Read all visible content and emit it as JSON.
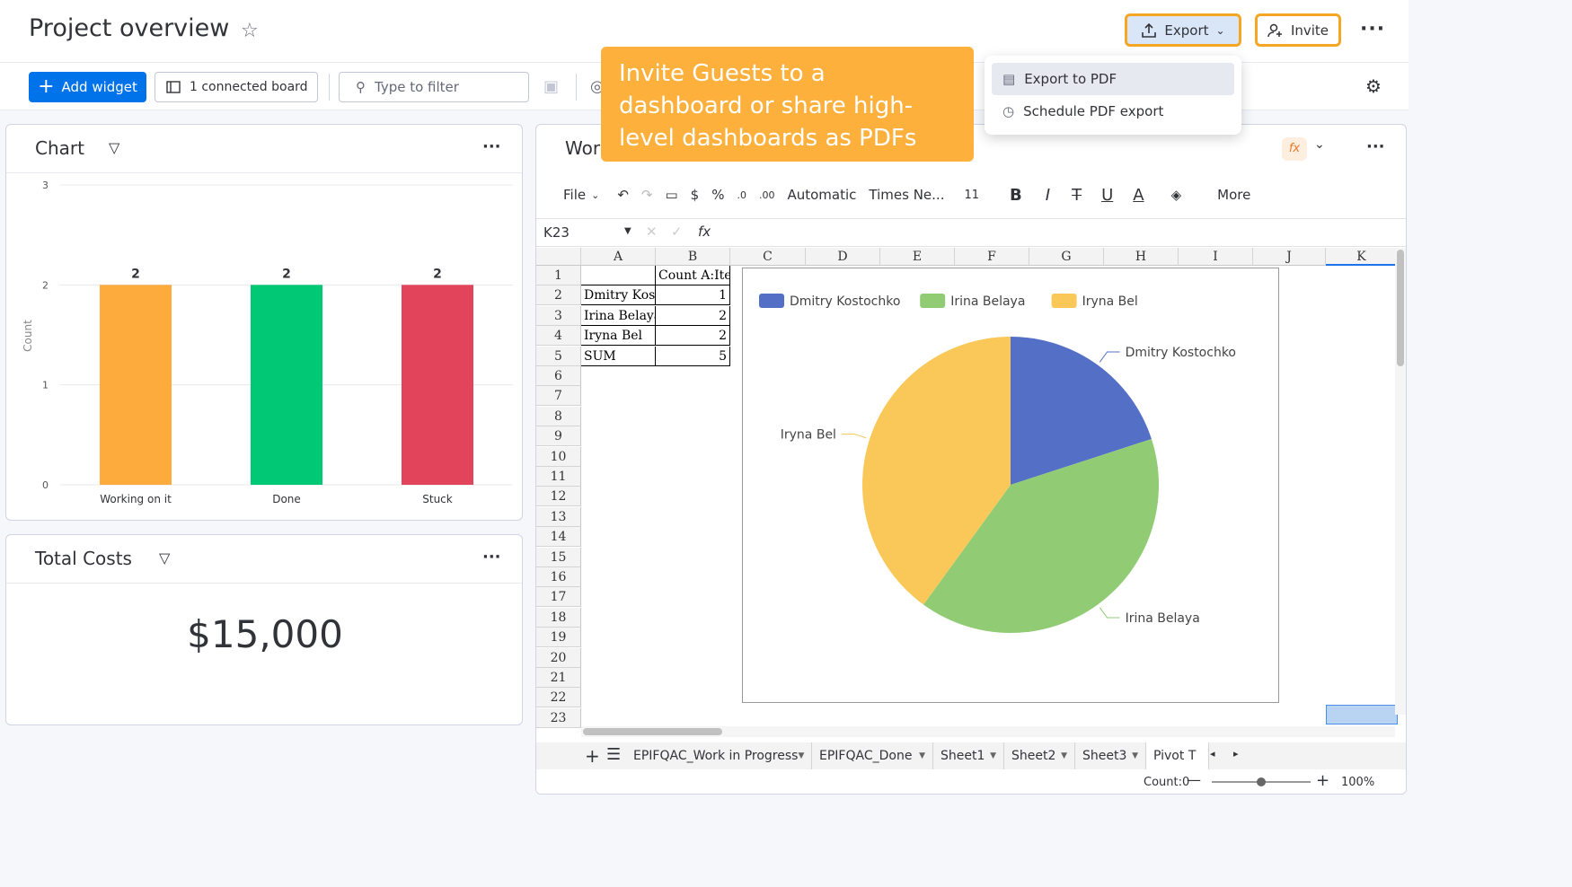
{
  "header": {
    "title": "Project overview",
    "export_label": "Export",
    "invite_label": "Invite"
  },
  "toolbar": {
    "add_widget_label": "Add widget",
    "connected_label": "1 connected board",
    "filter_placeholder": "Type to filter"
  },
  "tooltip": {
    "text": "Invite Guests to a dashboard or share high-level dashboards as PDFs"
  },
  "export_menu": {
    "items": [
      {
        "label": "Export to PDF"
      },
      {
        "label": "Schedule PDF export"
      }
    ]
  },
  "chart_widget": {
    "title": "Chart"
  },
  "costs_widget": {
    "title": "Total Costs",
    "value": "$15,000"
  },
  "workdoc_widget": {
    "title": "Wor"
  },
  "sheet": {
    "toolbar": {
      "file": "File",
      "dollar": "$",
      "percent": "%",
      "number_format": "Automatic",
      "font": "Times Ne...",
      "font_size": "11",
      "bold": "B",
      "italic": "I",
      "underline": "U",
      "font_color": "A",
      "more": "More"
    },
    "cell_ref": "K23",
    "fx": "fx",
    "columns": [
      "A",
      "B",
      "C",
      "D",
      "E",
      "F",
      "G",
      "H",
      "I",
      "J",
      "K"
    ],
    "rows": [
      "1",
      "2",
      "3",
      "4",
      "5",
      "6",
      "7",
      "8",
      "9",
      "10",
      "11",
      "12",
      "13",
      "14",
      "15",
      "16",
      "17",
      "18",
      "19",
      "20",
      "21",
      "22",
      "23"
    ],
    "table": [
      [
        "",
        "Count A:Ite"
      ],
      [
        "Dmitry Kos",
        "1"
      ],
      [
        "Irina Belaya",
        "2"
      ],
      [
        "Iryna Bel",
        "2"
      ],
      [
        "SUM",
        "5"
      ]
    ],
    "tabs": [
      "EPIFQAC_Work in Progress",
      "EPIFQAC_Done",
      "Sheet1",
      "Sheet2",
      "Sheet3",
      "Pivot T"
    ],
    "status_count": "Count:0",
    "zoom": "100%"
  },
  "chart_data": [
    {
      "type": "bar",
      "ylabel": "Count",
      "categories": [
        "Working on it",
        "Done",
        "Stuck"
      ],
      "values": [
        2,
        2,
        2
      ],
      "colors": [
        "#fdab3d",
        "#00c875",
        "#e2445c"
      ],
      "ylim": [
        0,
        3
      ],
      "yticks": [
        "0",
        "1",
        "2",
        "3"
      ],
      "grid": true
    },
    {
      "type": "pie",
      "categories": [
        "Dmitry Kostochko",
        "Irina Belaya",
        "Iryna Bel"
      ],
      "values": [
        1,
        2,
        2
      ],
      "colors": [
        "#5470c6",
        "#91cc75",
        "#fac858"
      ],
      "legend": "top-left"
    }
  ]
}
